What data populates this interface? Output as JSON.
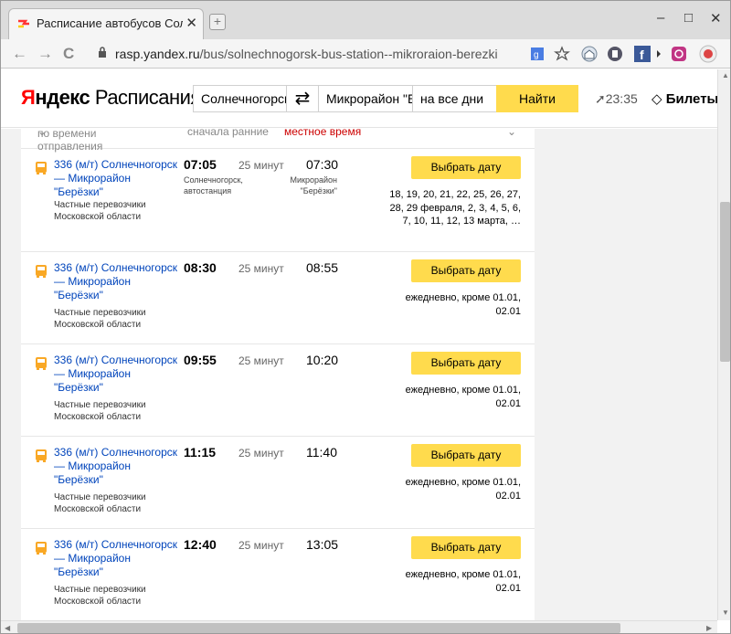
{
  "browser": {
    "tab_title": "Расписание автобусов Сол",
    "tab_close": "✕",
    "new_tab": "+",
    "win_minimize": "–",
    "win_maximize": "□",
    "win_close": "✕",
    "back": "←",
    "forward": "→",
    "reload": "C",
    "url_host": "rasp.yandex.ru",
    "url_path": "/bus/solnechnogorsk-bus-station--mikroraion-berezki"
  },
  "header": {
    "logo_ya_first": "Я",
    "logo_ya_rest": "ндекс",
    "logo_service": " Расписания",
    "from_value": "Солнечногорск",
    "swap": "⇄",
    "to_value": "Микрорайон \"Берёзки\"",
    "date_value": "на все дни",
    "find_label": "Найти",
    "time": "23:35",
    "tickets_label": "Билеты"
  },
  "sortbar": {
    "by_time": "по времени отправления",
    "order": "сначала ранние",
    "local_time": "местное время"
  },
  "rows": [
    {
      "route": "336 (м/т)   Солнечногорск — Микрорайон \"Берёзки\"",
      "carrier": "Частные перевозчики Московской области",
      "dep": "07:05",
      "duration": "25 минут",
      "arr": "07:30",
      "dep_station": "Солнечногорск, автостанция",
      "arr_station": "Микрорайон \"Берёзки\"",
      "button": "Выбрать дату",
      "days": "18, 19, 20, 21, 22, 25, 26, 27, 28, 29 февраля, 2, 3, 4, 5, 6, 7, 10, 11, 12, 13 марта, …"
    },
    {
      "route": "336 (м/т)   Солнечногорск — Микрорайон \"Берёзки\"",
      "carrier": "Частные перевозчики Московской области",
      "dep": "08:30",
      "duration": "25 минут",
      "arr": "08:55",
      "button": "Выбрать дату",
      "days": "ежедневно, кроме 01.01, 02.01"
    },
    {
      "route": "336 (м/т)   Солнечногорск — Микрорайон \"Берёзки\"",
      "carrier": "Частные перевозчики Московской области",
      "dep": "09:55",
      "duration": "25 минут",
      "arr": "10:20",
      "button": "Выбрать дату",
      "days": "ежедневно, кроме 01.01, 02.01"
    },
    {
      "route": "336 (м/т)   Солнечногорск — Микрорайон \"Берёзки\"",
      "carrier": "Частные перевозчики Московской области",
      "dep": "11:15",
      "duration": "25 минут",
      "arr": "11:40",
      "button": "Выбрать дату",
      "days": "ежедневно, кроме 01.01, 02.01"
    },
    {
      "route": "336 (м/т)   Солнечногорск — Микрорайон \"Берёзки\"",
      "carrier": "Частные перевозчики Московской области",
      "dep": "12:40",
      "duration": "25 минут",
      "arr": "13:05",
      "button": "Выбрать дату",
      "days": "ежедневно, кроме 01.01, 02.01"
    }
  ],
  "colors": {
    "accent_yellow": "#ffdb4d",
    "link_blue": "#0044bb",
    "logo_red": "#ff0000",
    "local_time_red": "#cc0000"
  }
}
